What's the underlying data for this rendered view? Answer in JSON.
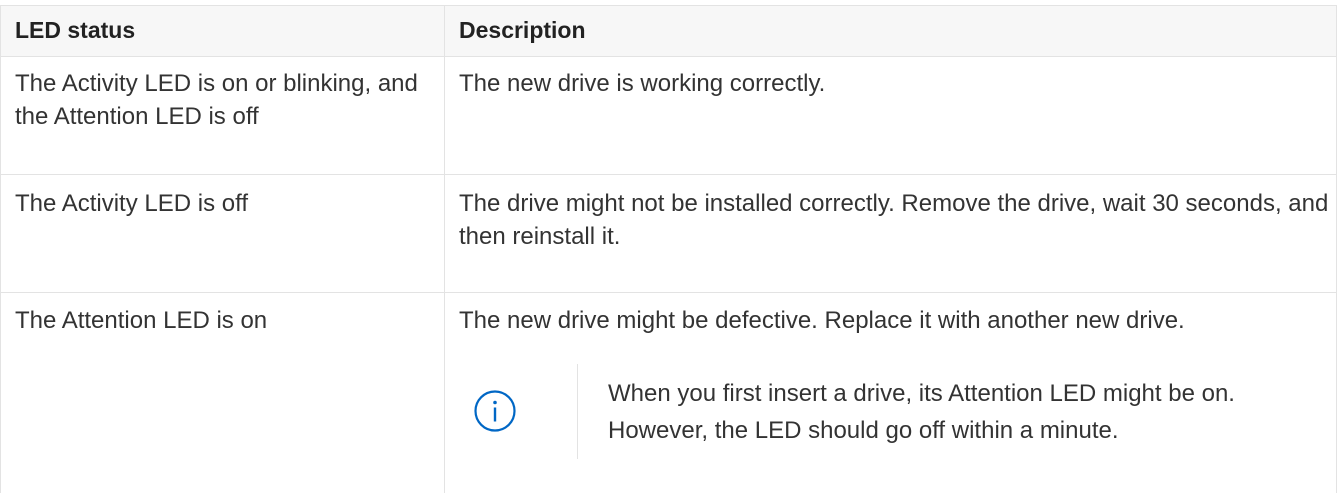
{
  "table": {
    "headers": {
      "led_status": "LED status",
      "description": "Description"
    },
    "rows": [
      {
        "status": "The Activity LED is on or blinking, and the Attention LED is off",
        "description": "The new drive is working correctly."
      },
      {
        "status": "The Activity LED is off",
        "description": "The drive might not be installed correctly. Remove the drive, wait 30 seconds, and then reinstall it."
      },
      {
        "status": "The Attention LED is on",
        "description": "The new drive might be defective. Replace it with another new drive.",
        "note": {
          "icon": "info-circle-icon",
          "text": "When you first insert a drive, its Attention LED might be on. However, the LED should go off within a minute."
        }
      }
    ]
  },
  "colors": {
    "header_bg": "#f7f7f7",
    "border": "#e3e3e3",
    "text": "#333333",
    "info_icon": "#0067c5"
  }
}
